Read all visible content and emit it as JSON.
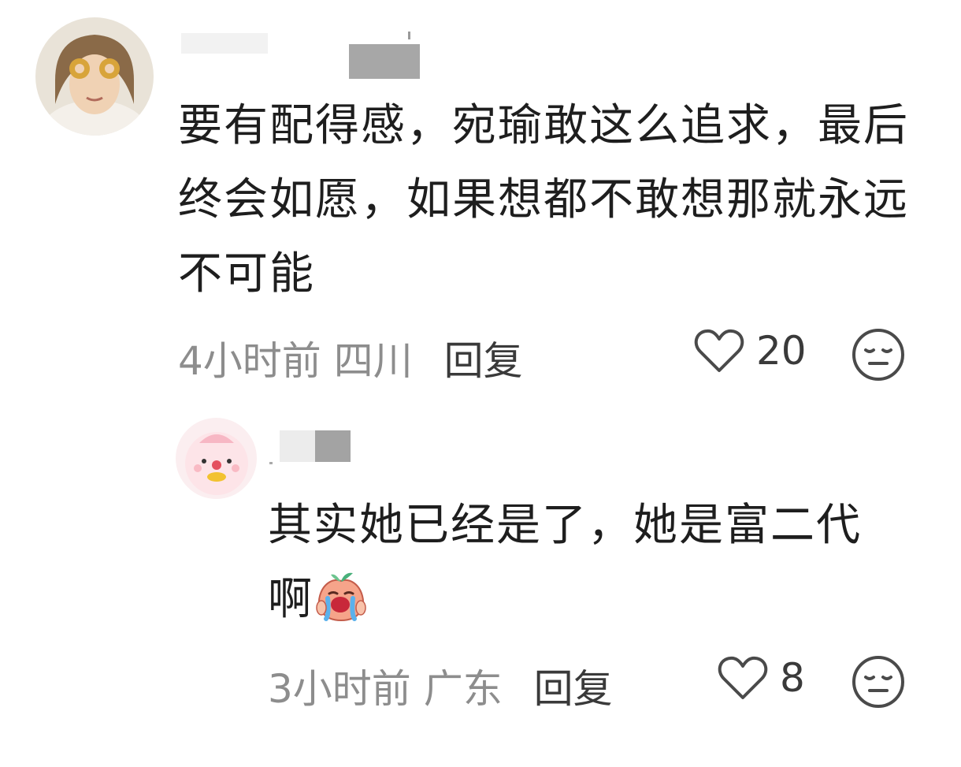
{
  "comments": [
    {
      "text": "要有配得感，宛瑜敢这么追求，最后终会如愿，如果想都不敢想那就永远不可能",
      "time": "4小时前",
      "location": "四川",
      "reply_label": "回复",
      "like_count": "20",
      "like_icon": "heart-outline-icon",
      "dislike_icon": "expressionless-face-icon"
    },
    {
      "text": "其实她已经是了，她是富二代啊",
      "emoji": "crying-peach-emoji",
      "time": "3小时前",
      "location": "广东",
      "reply_label": "回复",
      "like_count": "8",
      "like_icon": "heart-outline-icon",
      "dislike_icon": "expressionless-face-icon"
    }
  ],
  "colors": {
    "text": "#1e1e1e",
    "meta": "#8d8d8d",
    "accent": "#3a3a3a",
    "background": "#ffffff"
  }
}
